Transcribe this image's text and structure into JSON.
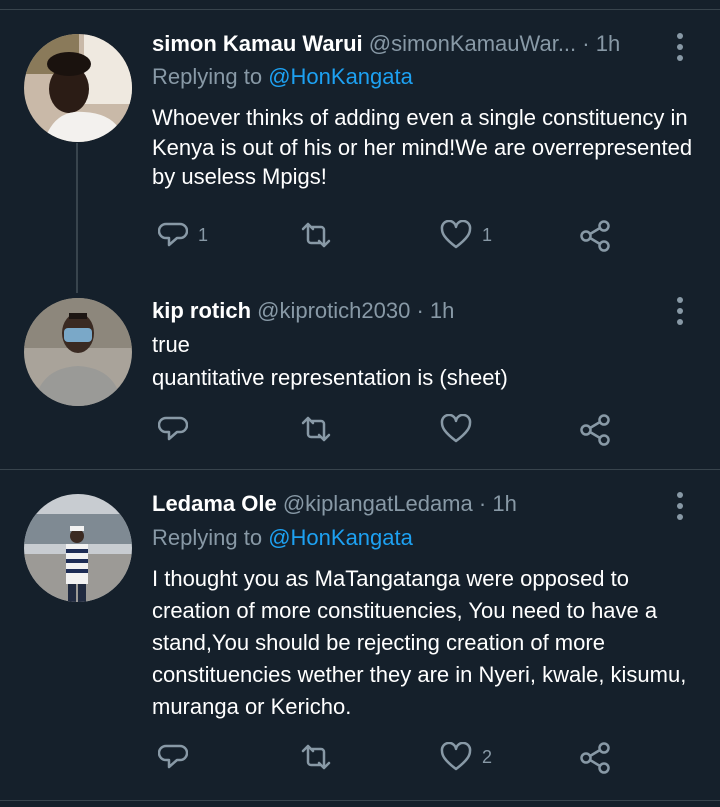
{
  "tweets": [
    {
      "name": "simon Kamau Warui",
      "handle": "@simonKamauWar...",
      "time": "1h",
      "reply_prefix": "Replying to",
      "reply_to": "@HonKangata",
      "text": "Whoever thinks of adding even a single constituency in Kenya is out of his or her mind!We are overrepresented by useless Mpigs!",
      "reply_count": "1",
      "retweet_count": "",
      "like_count": "1"
    },
    {
      "name": "kip rotich",
      "handle": "@kiprotich2030",
      "time": "1h",
      "text_lines": [
        "true",
        "quantitative representation is  (sheet)"
      ],
      "reply_count": "",
      "retweet_count": "",
      "like_count": ""
    },
    {
      "name": "Ledama Ole",
      "handle": "@kiplangatLedama",
      "time": "1h",
      "reply_prefix": "Replying to",
      "reply_to": "@HonKangata",
      "text": "I thought you as MaTangatanga were opposed to creation of more constituencies, You need to have a stand,You should be rejecting creation of more constituencies wether they are in Nyeri, kwale, kisumu, muranga or Kericho.",
      "reply_count": "",
      "retweet_count": "",
      "like_count": "2"
    }
  ],
  "colors": {
    "background": "#15202b",
    "secondary_text": "#8899a6",
    "link": "#1da1f2",
    "divider": "#38444d"
  },
  "icons": [
    "reply-icon",
    "retweet-icon",
    "like-icon",
    "share-icon",
    "more-options-icon"
  ]
}
